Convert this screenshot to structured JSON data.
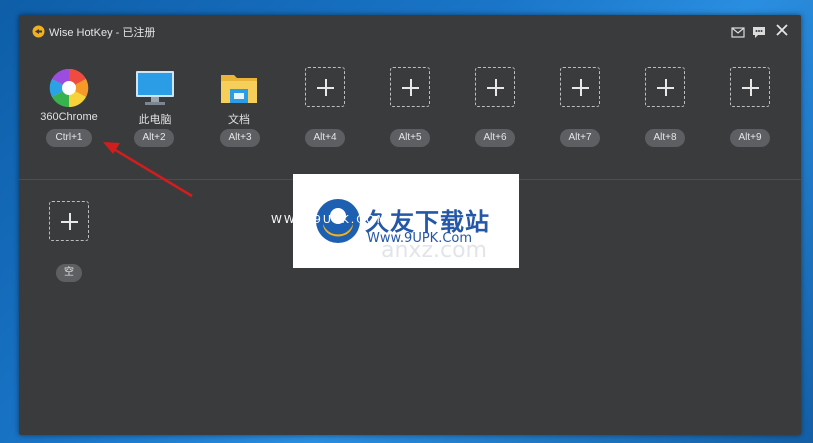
{
  "window": {
    "title": "Wise HotKey - 已注册"
  },
  "slots": [
    {
      "label": "360Chrome",
      "hotkey": "Ctrl+1",
      "icon": "chrome-360-icon"
    },
    {
      "label": "此电脑",
      "hotkey": "Alt+2",
      "icon": "computer-monitor-icon"
    },
    {
      "label": "文档",
      "hotkey": "Alt+3",
      "icon": "documents-folder-icon"
    },
    {
      "label": "",
      "hotkey": "Alt+4",
      "icon": "add-icon"
    },
    {
      "label": "",
      "hotkey": "Alt+5",
      "icon": "add-icon"
    },
    {
      "label": "",
      "hotkey": "Alt+6",
      "icon": "add-icon"
    },
    {
      "label": "",
      "hotkey": "Alt+7",
      "icon": "add-icon"
    },
    {
      "label": "",
      "hotkey": "Alt+8",
      "icon": "add-icon"
    },
    {
      "label": "",
      "hotkey": "Alt+9",
      "icon": "add-icon"
    }
  ],
  "second_row": {
    "hotkey_label": "空",
    "icon": "add-icon"
  },
  "watermark": {
    "brand": "久友下载站",
    "url": "Www.9UPK.Com",
    "small_url": "WWW.9UPK.COM",
    "overlay": "anxz.com"
  },
  "colors": {
    "window_bg": "#3a3b3d",
    "badge_bg": "#5d5f62",
    "arrow": "#d11d1d"
  }
}
